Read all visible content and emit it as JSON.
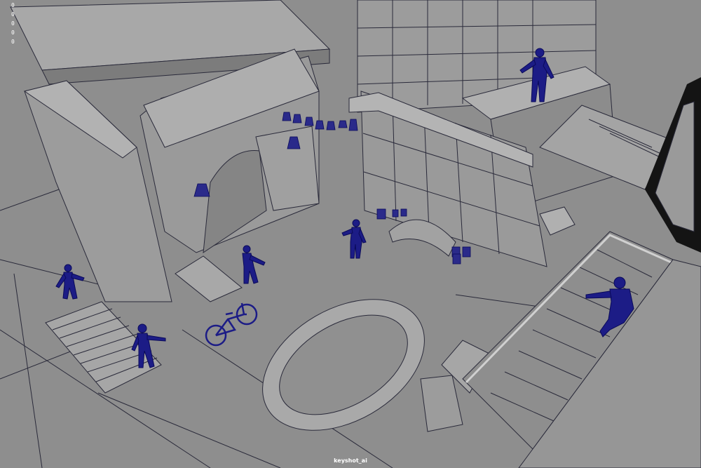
{
  "viewport": {
    "hud_lines": [
      "0",
      "0",
      "0",
      "0",
      "0"
    ],
    "camera_label": "keyshot_ai"
  },
  "colors": {
    "viewport_background": "#8e8e8e",
    "mesh_face": "#9a9a9a",
    "mesh_face_light": "#a6a6a6",
    "mesh_face_dark": "#7e7e7e",
    "wire_edge": "#2a2a3a",
    "character_wireframe": "#1c1c86",
    "hud_text": "#ffffff"
  },
  "icons": {
    "character": "humanoid-wireframe-icon",
    "bicycle": "bicycle-wireframe-icon",
    "lantern": "lantern-icon",
    "barrel": "barrel-icon"
  }
}
